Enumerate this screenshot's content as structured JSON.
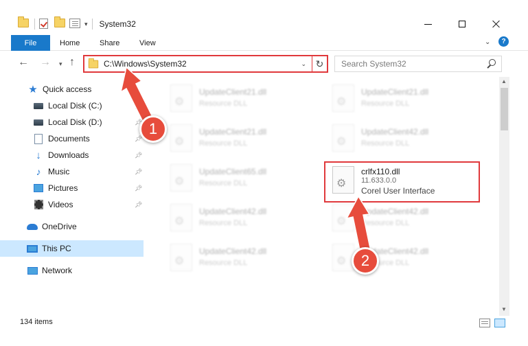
{
  "window": {
    "title": "System32",
    "colors": {
      "accent": "#1979ca",
      "highlight": "#e0383b",
      "selected": "#cce8ff"
    }
  },
  "ribbon": {
    "tabs": [
      "File",
      "Home",
      "Share",
      "View"
    ]
  },
  "address": {
    "path": "C:\\Windows\\System32",
    "search_placeholder": "Search System32"
  },
  "sidebar": {
    "items": [
      {
        "label": "Quick access",
        "icon": "star-icon",
        "pinned": false
      },
      {
        "label": "Local Disk (C:)",
        "icon": "disk-icon",
        "pinned": true
      },
      {
        "label": "Local Disk (D:)",
        "icon": "disk-icon",
        "pinned": true
      },
      {
        "label": "Documents",
        "icon": "documents-icon",
        "pinned": true
      },
      {
        "label": "Downloads",
        "icon": "downloads-icon",
        "pinned": true
      },
      {
        "label": "Music",
        "icon": "music-icon",
        "pinned": true
      },
      {
        "label": "Pictures",
        "icon": "pictures-icon",
        "pinned": true
      },
      {
        "label": "Videos",
        "icon": "videos-icon",
        "pinned": true
      },
      {
        "label": "OneDrive",
        "icon": "onedrive-icon",
        "pinned": false
      },
      {
        "label": "This PC",
        "icon": "this-pc-icon",
        "pinned": false,
        "selected": true
      },
      {
        "label": "Network",
        "icon": "network-icon",
        "pinned": false
      }
    ]
  },
  "files": {
    "items": [
      {
        "name": "UpdateClient21.dll",
        "type": "Resource DLL"
      },
      {
        "name": "UpdateClient21.dll",
        "type": "Resource DLL"
      },
      {
        "name": "UpdateClient21.dll",
        "type": "Resource DLL"
      },
      {
        "name": "UpdateClient42.dll",
        "type": "Resource DLL"
      },
      {
        "name": "UpdateClient65.dll",
        "type": "Resource DLL"
      },
      {
        "name": "UpdateClient42.dll",
        "type": "Resource DLL"
      },
      {
        "name": "UpdateClient42.dll",
        "type": "Resource DLL"
      },
      {
        "name": "UpdateClient42.dll",
        "type": "Resource DLL"
      },
      {
        "name": "UpdateClient42.dll",
        "type": "Resource DLL"
      }
    ],
    "highlighted": {
      "name": "crlfx110.dll",
      "version": "11.633.0.0",
      "description": "Corel User Interface"
    }
  },
  "annotations": {
    "step1": "1",
    "step2": "2"
  },
  "status": {
    "item_count": "134 items"
  }
}
